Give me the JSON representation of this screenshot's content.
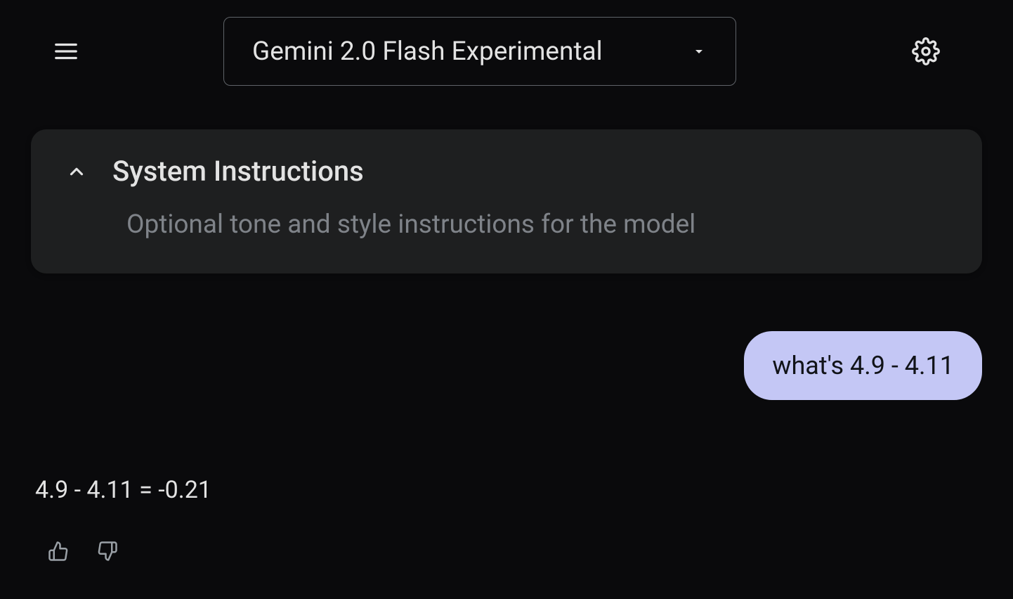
{
  "header": {
    "model_label": "Gemini 2.0 Flash Experimental"
  },
  "system": {
    "title": "System Instructions",
    "placeholder": "Optional tone and style instructions for the model"
  },
  "conversation": {
    "user_message": "what's 4.9 - 4.11",
    "assistant_message": "4.9 - 4.11 = -0.21"
  }
}
